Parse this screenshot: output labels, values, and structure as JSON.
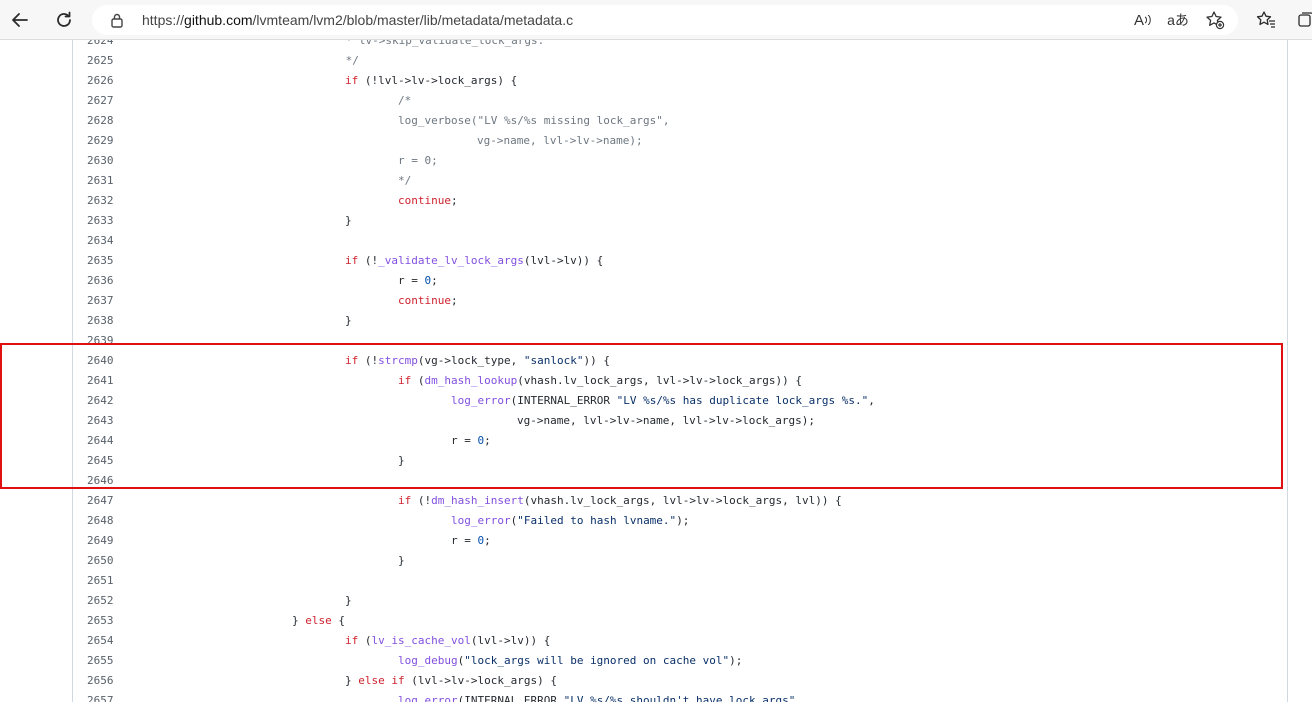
{
  "browser": {
    "url_scheme": "https://",
    "url_host": "github.com",
    "url_path": "/lvmteam/lvm2/blob/master/lib/metadata/metadata.c",
    "read_aloud_glyph": "A",
    "translate_glyph": "aあ"
  },
  "code": {
    "lines": [
      {
        "n": "2624",
        "indent": 0,
        "tokens": [
          {
            "t": " * lv->skip_validate_lock_args.",
            "c": "cm"
          }
        ],
        "col": 338
      },
      {
        "n": "2625",
        "tokens": [
          {
            "t": " */",
            "c": "cm"
          }
        ],
        "col": 338
      },
      {
        "n": "2626",
        "tokens": [
          {
            "t": "if",
            "c": "kw"
          },
          {
            "t": " (!lvl->lv->lock_args) {",
            "c": ""
          }
        ],
        "col": 344
      },
      {
        "n": "2627",
        "tokens": [
          {
            "t": "/*",
            "c": "cm"
          }
        ],
        "col": 397
      },
      {
        "n": "2628",
        "tokens": [
          {
            "t": "log_verbose(\"LV %s/%s missing lock_args\",",
            "c": "cm"
          }
        ],
        "col": 397
      },
      {
        "n": "2629",
        "tokens": [
          {
            "t": "vg->name, lvl->lv->name);",
            "c": "cm"
          }
        ],
        "col": 476
      },
      {
        "n": "2630",
        "tokens": [
          {
            "t": "r = 0;",
            "c": "cm"
          }
        ],
        "col": 397
      },
      {
        "n": "2631",
        "tokens": [
          {
            "t": "*/",
            "c": "cm"
          }
        ],
        "col": 397
      },
      {
        "n": "2632",
        "tokens": [
          {
            "t": "continue",
            "c": "kw"
          },
          {
            "t": ";",
            "c": ""
          }
        ],
        "col": 397
      },
      {
        "n": "2633",
        "tokens": [
          {
            "t": "}",
            "c": ""
          }
        ],
        "col": 344
      },
      {
        "n": "2634",
        "tokens": [],
        "col": 344
      },
      {
        "n": "2635",
        "tokens": [
          {
            "t": "if",
            "c": "kw"
          },
          {
            "t": " (!",
            "c": ""
          },
          {
            "t": "_validate_lv_lock_args",
            "c": "fn"
          },
          {
            "t": "(lvl->lv)) {",
            "c": ""
          }
        ],
        "col": 344
      },
      {
        "n": "2636",
        "tokens": [
          {
            "t": "r = ",
            "c": ""
          },
          {
            "t": "0",
            "c": "num"
          },
          {
            "t": ";",
            "c": ""
          }
        ],
        "col": 397
      },
      {
        "n": "2637",
        "tokens": [
          {
            "t": "continue",
            "c": "kw"
          },
          {
            "t": ";",
            "c": ""
          }
        ],
        "col": 397
      },
      {
        "n": "2638",
        "tokens": [
          {
            "t": "}",
            "c": ""
          }
        ],
        "col": 344
      },
      {
        "n": "2639",
        "tokens": [],
        "col": 344
      },
      {
        "n": "2640",
        "tokens": [
          {
            "t": "if",
            "c": "kw"
          },
          {
            "t": " (!",
            "c": ""
          },
          {
            "t": "strcmp",
            "c": "fn"
          },
          {
            "t": "(vg->lock_type, ",
            "c": ""
          },
          {
            "t": "\"sanlock\"",
            "c": "str"
          },
          {
            "t": ")) {",
            "c": ""
          }
        ],
        "col": 344
      },
      {
        "n": "2641",
        "tokens": [
          {
            "t": "if",
            "c": "kw"
          },
          {
            "t": " (",
            "c": ""
          },
          {
            "t": "dm_hash_lookup",
            "c": "fn"
          },
          {
            "t": "(vhash.lv_lock_args, lvl->lv->lock_args)) {",
            "c": ""
          }
        ],
        "col": 397
      },
      {
        "n": "2642",
        "tokens": [
          {
            "t": "log_error",
            "c": "fn"
          },
          {
            "t": "(INTERNAL_ERROR ",
            "c": ""
          },
          {
            "t": "\"LV %s/%s has duplicate lock_args %s.\"",
            "c": "str"
          },
          {
            "t": ",",
            "c": ""
          }
        ],
        "col": 450
      },
      {
        "n": "2643",
        "tokens": [
          {
            "t": "vg->name, lvl->lv->name, lvl->lv->lock_args);",
            "c": ""
          }
        ],
        "col": 516
      },
      {
        "n": "2644",
        "tokens": [
          {
            "t": "r = ",
            "c": ""
          },
          {
            "t": "0",
            "c": "num"
          },
          {
            "t": ";",
            "c": ""
          }
        ],
        "col": 450
      },
      {
        "n": "2645",
        "tokens": [
          {
            "t": "}",
            "c": ""
          }
        ],
        "col": 397
      },
      {
        "n": "2646",
        "tokens": [],
        "col": 397
      },
      {
        "n": "2647",
        "tokens": [
          {
            "t": "if",
            "c": "kw"
          },
          {
            "t": " (!",
            "c": ""
          },
          {
            "t": "dm_hash_insert",
            "c": "fn"
          },
          {
            "t": "(vhash.lv_lock_args, lvl->lv->lock_args, lvl)) {",
            "c": ""
          }
        ],
        "col": 397
      },
      {
        "n": "2648",
        "tokens": [
          {
            "t": "log_error",
            "c": "fn"
          },
          {
            "t": "(",
            "c": ""
          },
          {
            "t": "\"Failed to hash lvname.\"",
            "c": "str"
          },
          {
            "t": ");",
            "c": ""
          }
        ],
        "col": 450
      },
      {
        "n": "2649",
        "tokens": [
          {
            "t": "r = ",
            "c": ""
          },
          {
            "t": "0",
            "c": "num"
          },
          {
            "t": ";",
            "c": ""
          }
        ],
        "col": 450
      },
      {
        "n": "2650",
        "tokens": [
          {
            "t": "}",
            "c": ""
          }
        ],
        "col": 397
      },
      {
        "n": "2651",
        "tokens": [],
        "col": 397
      },
      {
        "n": "2652",
        "tokens": [
          {
            "t": "}",
            "c": ""
          }
        ],
        "col": 344
      },
      {
        "n": "2653",
        "tokens": [
          {
            "t": "} ",
            "c": ""
          },
          {
            "t": "else",
            "c": "kw"
          },
          {
            "t": " {",
            "c": ""
          }
        ],
        "col": 291
      },
      {
        "n": "2654",
        "tokens": [
          {
            "t": "if",
            "c": "kw"
          },
          {
            "t": " (",
            "c": ""
          },
          {
            "t": "lv_is_cache_vol",
            "c": "fn"
          },
          {
            "t": "(lvl->lv)) {",
            "c": ""
          }
        ],
        "col": 344
      },
      {
        "n": "2655",
        "tokens": [
          {
            "t": "log_debug",
            "c": "fn"
          },
          {
            "t": "(",
            "c": ""
          },
          {
            "t": "\"lock_args will be ignored on cache vol\"",
            "c": "str"
          },
          {
            "t": ");",
            "c": ""
          }
        ],
        "col": 397
      },
      {
        "n": "2656",
        "tokens": [
          {
            "t": "} ",
            "c": ""
          },
          {
            "t": "else",
            "c": "kw"
          },
          {
            "t": " ",
            "c": ""
          },
          {
            "t": "if",
            "c": "kw"
          },
          {
            "t": " (lvl->lv->lock_args) {",
            "c": ""
          }
        ],
        "col": 344
      },
      {
        "n": "2657",
        "tokens": [
          {
            "t": "log_error",
            "c": "fn"
          },
          {
            "t": "(INTERNAL_ERROR ",
            "c": ""
          },
          {
            "t": "\"LV %s/%s shouldn't have lock_args\"",
            "c": "str"
          },
          {
            "t": ",",
            "c": ""
          }
        ],
        "col": 397
      }
    ]
  },
  "colors": {
    "highlight_box": "#e01010",
    "keyword": "#cf222e",
    "function": "#8250df",
    "string": "#0a3069",
    "comment": "#6e7781"
  }
}
